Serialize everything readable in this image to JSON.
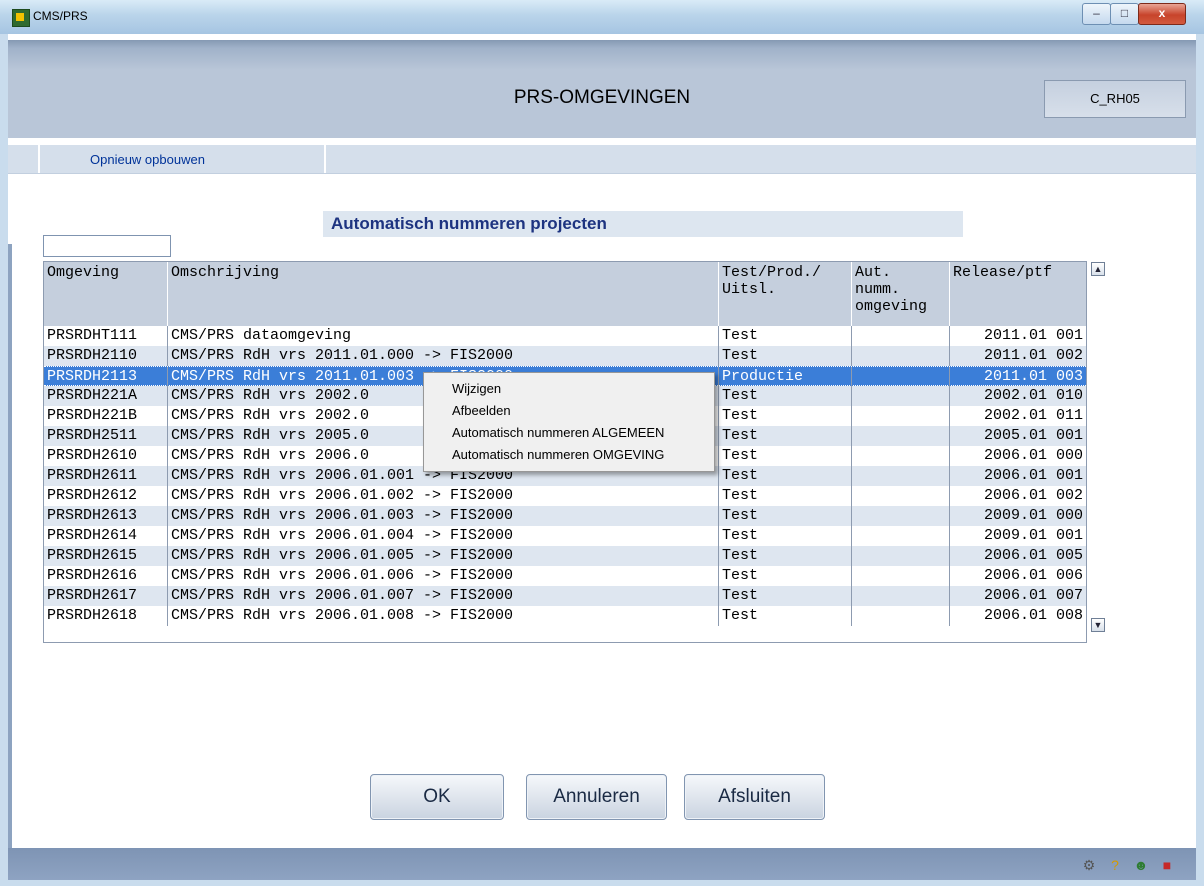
{
  "window": {
    "title": "CMS/PRS",
    "min_label": "–",
    "max_label": "□",
    "close_label": "x"
  },
  "header": {
    "title": "PRS-OMGEVINGEN",
    "screen_code": "C_RH05"
  },
  "actions": {
    "rebuild_label": "Opnieuw opbouwen"
  },
  "section": {
    "title": "Automatisch nummeren projecten"
  },
  "filter": {
    "value": ""
  },
  "table": {
    "columns": [
      "Omgeving",
      "Omschrijving",
      "Test/Prod./\nUitsl.",
      "Aut.\nnumm.\nomgeving",
      "Release/ptf"
    ],
    "rows": [
      {
        "omgeving": "PRSRDHT111",
        "omschrijving": "CMS/PRS dataomgeving",
        "type": "Test",
        "aut": "",
        "release": "2011.01 001"
      },
      {
        "omgeving": "PRSRDH2110",
        "omschrijving": "CMS/PRS RdH vrs 2011.01.000 -> FIS2000",
        "type": "Test",
        "aut": "",
        "release": "2011.01 002"
      },
      {
        "omgeving": "PRSRDH2113",
        "omschrijving": "CMS/PRS RdH vrs 2011.01.003 -> FIS2000",
        "type": "Productie",
        "aut": "",
        "release": "2011.01 003"
      },
      {
        "omgeving": "PRSRDH221A",
        "omschrijving": "CMS/PRS RdH vrs 2002.0",
        "type": "Test",
        "aut": "",
        "release": "2002.01 010"
      },
      {
        "omgeving": "PRSRDH221B",
        "omschrijving": "CMS/PRS RdH vrs 2002.0",
        "type": "Test",
        "aut": "",
        "release": "2002.01 011"
      },
      {
        "omgeving": "PRSRDH2511",
        "omschrijving": "CMS/PRS RdH vrs 2005.0",
        "type": "Test",
        "aut": "",
        "release": "2005.01 001"
      },
      {
        "omgeving": "PRSRDH2610",
        "omschrijving": "CMS/PRS RdH vrs 2006.0",
        "type": "Test",
        "aut": "",
        "release": "2006.01 000"
      },
      {
        "omgeving": "PRSRDH2611",
        "omschrijving": "CMS/PRS RdH vrs 2006.01.001 -> FIS2000",
        "type": "Test",
        "aut": "",
        "release": "2006.01 001"
      },
      {
        "omgeving": "PRSRDH2612",
        "omschrijving": "CMS/PRS RdH vrs 2006.01.002 -> FIS2000",
        "type": "Test",
        "aut": "",
        "release": "2006.01 002"
      },
      {
        "omgeving": "PRSRDH2613",
        "omschrijving": "CMS/PRS RdH vrs 2006.01.003 -> FIS2000",
        "type": "Test",
        "aut": "",
        "release": "2009.01 000"
      },
      {
        "omgeving": "PRSRDH2614",
        "omschrijving": "CMS/PRS RdH vrs 2006.01.004 -> FIS2000",
        "type": "Test",
        "aut": "",
        "release": "2009.01 001"
      },
      {
        "omgeving": "PRSRDH2615",
        "omschrijving": "CMS/PRS RdH vrs 2006.01.005 -> FIS2000",
        "type": "Test",
        "aut": "",
        "release": "2006.01 005"
      },
      {
        "omgeving": "PRSRDH2616",
        "omschrijving": "CMS/PRS RdH vrs 2006.01.006 -> FIS2000",
        "type": "Test",
        "aut": "",
        "release": "2006.01 006"
      },
      {
        "omgeving": "PRSRDH2617",
        "omschrijving": "CMS/PRS RdH vrs 2006.01.007 -> FIS2000",
        "type": "Test",
        "aut": "",
        "release": "2006.01 007"
      },
      {
        "omgeving": "PRSRDH2618",
        "omschrijving": "CMS/PRS RdH vrs 2006.01.008 -> FIS2000",
        "type": "Test",
        "aut": "",
        "release": "2006.01 008"
      }
    ],
    "selected_index": 2
  },
  "context_menu": {
    "items": [
      "Wijzigen",
      "Afbeelden",
      "Automatisch nummeren ALGEMEEN",
      "Automatisch nummeren OMGEVING"
    ]
  },
  "buttons": {
    "ok": "OK",
    "cancel": "Annuleren",
    "close": "Afsluiten"
  },
  "status_icons": [
    "tools-icon",
    "help-icon",
    "user-icon",
    "exit-icon"
  ],
  "colors": {
    "selection": "#3b7ed8",
    "title_text": "#1d3380",
    "link": "#003399"
  }
}
